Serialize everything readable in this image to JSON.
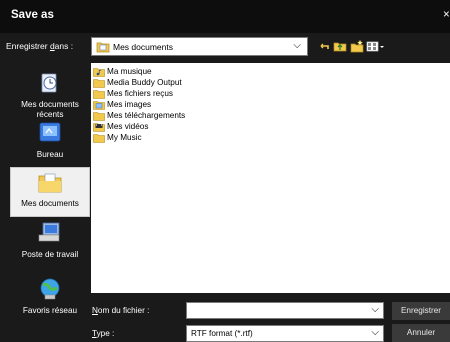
{
  "window": {
    "title": "Save as",
    "close_glyph": "×"
  },
  "lookin": {
    "label_pre": "Enregistrer ",
    "label_underline": "d",
    "label_post": "ans :",
    "value": "Mes documents",
    "icon": "folder-documents-icon"
  },
  "toolbar": {
    "icons": [
      "back-arrow-icon",
      "up-folder-icon",
      "new-folder-icon",
      "view-menu-icon"
    ]
  },
  "places": [
    {
      "label": "Mes documents récents",
      "icon": "recent-documents-icon",
      "selected": false
    },
    {
      "label": "Bureau",
      "icon": "desktop-icon",
      "selected": false
    },
    {
      "label": "Mes documents",
      "icon": "my-documents-icon",
      "selected": true
    },
    {
      "label": "Poste de travail",
      "icon": "my-computer-icon",
      "selected": false
    },
    {
      "label": "Favoris réseau",
      "icon": "network-places-icon",
      "selected": false
    }
  ],
  "files": [
    {
      "label": "Ma musique",
      "icon": "music-folder-icon"
    },
    {
      "label": "Media Buddy Output",
      "icon": "folder-icon"
    },
    {
      "label": "Mes fichiers reçus",
      "icon": "folder-icon"
    },
    {
      "label": "Mes images",
      "icon": "pictures-folder-icon"
    },
    {
      "label": "Mes téléchargements",
      "icon": "folder-icon"
    },
    {
      "label": "Mes vidéos",
      "icon": "videos-folder-icon"
    },
    {
      "label": "My Music",
      "icon": "folder-icon"
    }
  ],
  "filename": {
    "label_underline": "N",
    "label_rest": "om du fichier :",
    "value": ""
  },
  "filetype": {
    "label_underline": "T",
    "label_rest": "ype :",
    "value": "RTF format (*.rtf)"
  },
  "buttons": {
    "save": "Enregistrer",
    "cancel": "Annuler"
  },
  "colors": {
    "background": "#1a1a1a",
    "titlebar": "#0d0d0d",
    "folder": "#f2c94c",
    "button": "#3a3a3a"
  }
}
